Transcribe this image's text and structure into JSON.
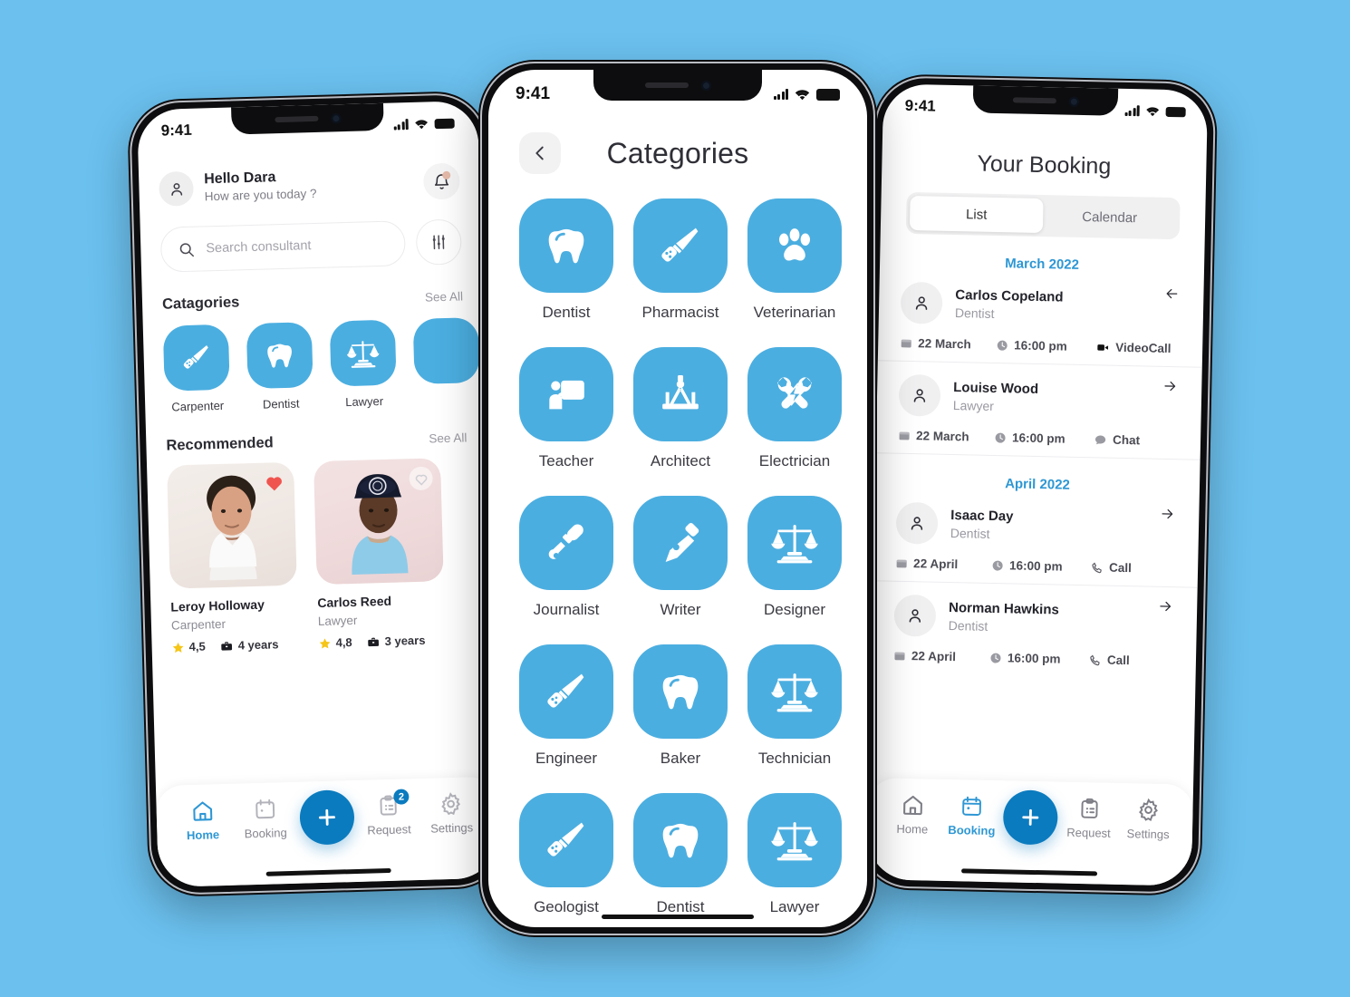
{
  "theme": {
    "background": "#6BC0EE",
    "tile_blue": "#4BAEE0",
    "accent_blue": "#2E97D4",
    "fab_blue": "#0B7BBF",
    "star_yellow": "#F5C518",
    "heart_red": "#F0544F"
  },
  "home_screen": {
    "status": {
      "time": "9:41"
    },
    "greeting": {
      "title": "Hello Dara",
      "subtitle": "How are you today ?"
    },
    "search": {
      "placeholder": "Search consultant",
      "value": ""
    },
    "categories_section": {
      "title": "Catagories",
      "see_all": "See All"
    },
    "categories": [
      {
        "label": "Carpenter",
        "icon": "saw-icon"
      },
      {
        "label": "Dentist",
        "icon": "tooth-icon"
      },
      {
        "label": "Lawyer",
        "icon": "scales-icon"
      },
      {
        "label": "",
        "icon": "partial-icon"
      }
    ],
    "recommended_section": {
      "title": "Recommended",
      "see_all": "See All"
    },
    "recommended": [
      {
        "name": "Leroy Holloway",
        "role": "Carpenter",
        "rating": "4,5",
        "experience": "4 years",
        "favorite": true
      },
      {
        "name": "Carlos Reed",
        "role": "Lawyer",
        "rating": "4,8",
        "experience": "3 years",
        "favorite": false
      }
    ],
    "tabs": [
      {
        "label": "Home",
        "icon": "home-icon",
        "active": true,
        "badge": ""
      },
      {
        "label": "Booking",
        "icon": "calendar-icon",
        "active": false,
        "badge": ""
      },
      {
        "label": "Request",
        "icon": "clipboard-icon",
        "active": false,
        "badge": "2"
      },
      {
        "label": "Settings",
        "icon": "gear-icon",
        "active": false,
        "badge": ""
      }
    ],
    "fab": {
      "label": "+",
      "icon": "plus-icon"
    }
  },
  "categories_screen": {
    "status": {
      "time": "9:41"
    },
    "title": "Categories",
    "back": "back-icon",
    "items": [
      {
        "label": "Dentist",
        "icon": "tooth-icon"
      },
      {
        "label": "Pharmacist",
        "icon": "saw-icon"
      },
      {
        "label": "Veterinarian",
        "icon": "paw-icon"
      },
      {
        "label": "Teacher",
        "icon": "whiteboard-icon"
      },
      {
        "label": "Architect",
        "icon": "compass-icon"
      },
      {
        "label": "Electrician",
        "icon": "wrench-bolt-icon"
      },
      {
        "label": "Journalist",
        "icon": "microphone-icon"
      },
      {
        "label": "Writer",
        "icon": "pen-nib-icon"
      },
      {
        "label": "Designer",
        "icon": "scales-icon"
      },
      {
        "label": "Engineer",
        "icon": "saw-icon"
      },
      {
        "label": "Baker",
        "icon": "tooth-icon"
      },
      {
        "label": "Technician",
        "icon": "scales-icon"
      },
      {
        "label": "Geologist",
        "icon": "saw-icon"
      },
      {
        "label": "Dentist",
        "icon": "tooth-icon"
      },
      {
        "label": "Lawyer",
        "icon": "scales-icon"
      }
    ]
  },
  "booking_screen": {
    "status": {
      "time": "9:41"
    },
    "title": "Your Booking",
    "tabs": [
      {
        "label": "List",
        "active": true
      },
      {
        "label": "Calendar",
        "active": false
      }
    ],
    "groups": [
      {
        "month": "March 2022",
        "bookings": [
          {
            "name": "Carlos Copeland",
            "role": "Dentist",
            "date": "22 March",
            "time": "16:00 pm",
            "channel": "VideoCall",
            "channel_icon": "video-icon",
            "arrow": "arrow-left-icon"
          },
          {
            "name": "Louise Wood",
            "role": "Lawyer",
            "date": "22 March",
            "time": "16:00 pm",
            "channel": "Chat",
            "channel_icon": "chat-icon",
            "arrow": "arrow-right-icon"
          }
        ]
      },
      {
        "month": "April 2022",
        "bookings": [
          {
            "name": "Isaac Day",
            "role": "Dentist",
            "date": "22 April",
            "time": "16:00 pm",
            "channel": "Call",
            "channel_icon": "phone-icon",
            "arrow": "arrow-right-icon"
          },
          {
            "name": "Norman Hawkins",
            "role": "Dentist",
            "date": "22 April",
            "time": "16:00 pm",
            "channel": "Call",
            "channel_icon": "phone-icon",
            "arrow": "arrow-right-icon"
          }
        ]
      }
    ],
    "tabs_bottom": [
      {
        "label": "Home",
        "icon": "home-icon",
        "active": false,
        "badge": ""
      },
      {
        "label": "Booking",
        "icon": "calendar-icon",
        "active": true,
        "badge": ""
      },
      {
        "label": "Request",
        "icon": "clipboard-icon",
        "active": false,
        "badge": ""
      },
      {
        "label": "Settings",
        "icon": "gear-icon",
        "active": false,
        "badge": ""
      }
    ],
    "fab": {
      "label": "+",
      "icon": "plus-icon"
    }
  }
}
